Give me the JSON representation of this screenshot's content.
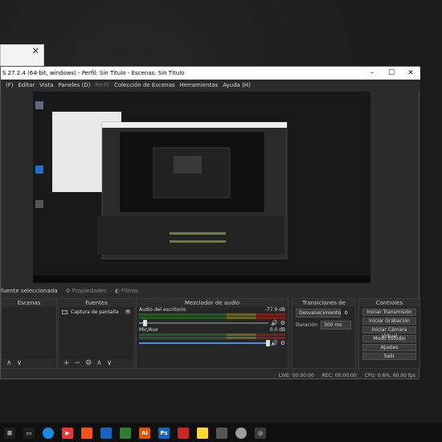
{
  "window_title": "S 27.2.4 (64-bit, windows) - Perfil: Sin Título - Escenas: Sin Título",
  "menu": [
    "(F)",
    "Editar",
    "Vista",
    "Paneles (D)",
    "Perfil",
    "Colección de Escenas",
    "Herramientas",
    "Ayuda (H)"
  ],
  "below_preview": {
    "status_text": "fuente seleccionada",
    "props_label": "Propiedades",
    "filters_label": "Filtros"
  },
  "docks": {
    "scenes_title": "Escenas",
    "sources_title": "Fuentes",
    "source_item": "Captura de pantalla",
    "mixer_title": "Mezclador de audio",
    "mixer_channels": [
      {
        "name": "Audio del escritorio",
        "db": "-77.9 dB",
        "level": 0.05
      },
      {
        "name": "Mic/Aux",
        "db": "0.0 dB",
        "level": 1.0
      }
    ],
    "transitions_title": "Transiciones de escena",
    "transition_value": "Desvanecimiento",
    "duration_label": "Duración",
    "duration_value": "300 ms",
    "controls_title": "Controles",
    "controls": [
      "Iniciar Transmisión",
      "Iniciar Grabación",
      "Iniciar Cámara Virtual",
      "Modo Estudio",
      "Ajustes",
      "Salir"
    ]
  },
  "status": {
    "live": "LIVE: 00:00:00",
    "rec": "REC: 00:00:00",
    "cpu": "CPU: 0.6%, 60.00 fps"
  },
  "colors": {
    "accent": "#4a90d9",
    "panel": "#262626"
  }
}
